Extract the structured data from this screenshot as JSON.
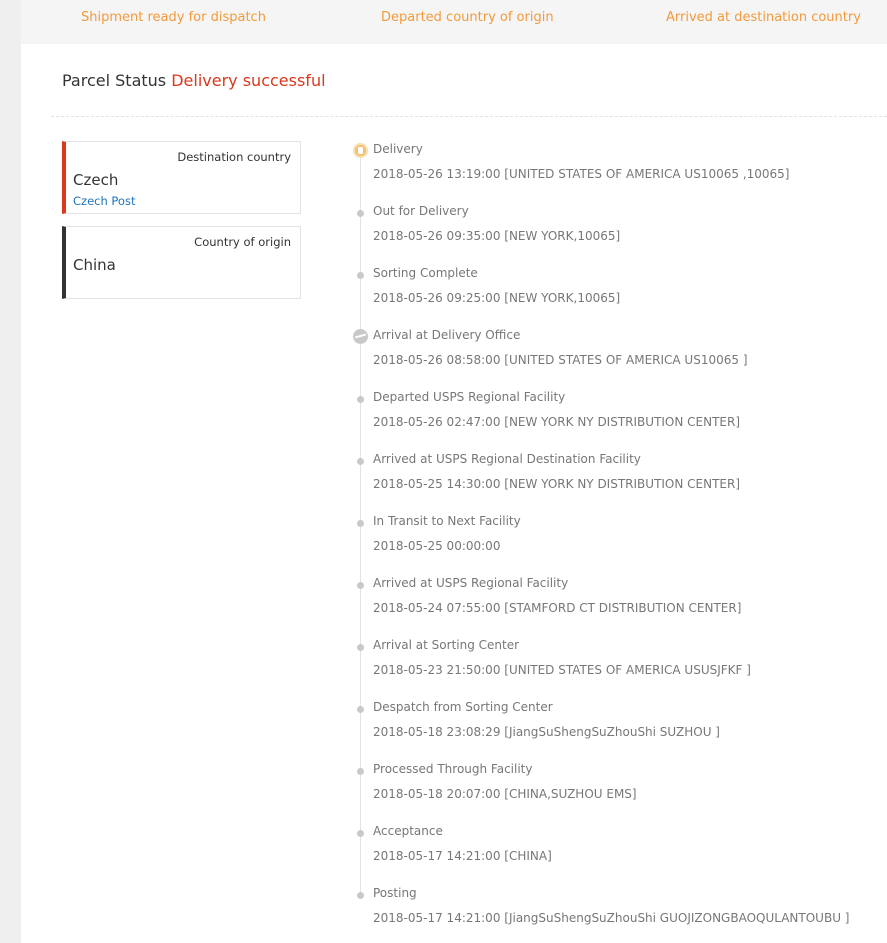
{
  "steps": [
    {
      "label": "Shipment ready for dispatch"
    },
    {
      "label": "Departed country of origin"
    },
    {
      "label": "Arrived at destination country"
    }
  ],
  "status": {
    "label": "Parcel Status",
    "value": "Delivery successful",
    "value_color": "#d9381e"
  },
  "destination": {
    "role": "Destination country",
    "country": "Czech",
    "carrier": "Czech Post",
    "accent": "#d9381e"
  },
  "origin": {
    "role": "Country of origin",
    "country": "China",
    "accent": "#333333"
  },
  "events": [
    {
      "title": "Delivery",
      "detail": "2018-05-26 13:19:00 [UNITED STATES OF AMERICA US10065 ,10065]",
      "icon": "delivered-icon"
    },
    {
      "title": "Out for Delivery",
      "detail": "2018-05-26 09:35:00 [NEW YORK,10065]",
      "icon": "dot-icon"
    },
    {
      "title": "Sorting Complete",
      "detail": "2018-05-26 09:25:00 [NEW YORK,10065]",
      "icon": "dot-icon"
    },
    {
      "title": "Arrival at Delivery Office",
      "detail": "2018-05-26 08:58:00 [UNITED STATES OF AMERICA US10065 ]",
      "icon": "plane-landing-icon"
    },
    {
      "title": "Departed USPS Regional Facility",
      "detail": "2018-05-26 02:47:00 [NEW YORK NY DISTRIBUTION CENTER]",
      "icon": "dot-icon"
    },
    {
      "title": "Arrived at USPS Regional Destination Facility",
      "detail": "2018-05-25 14:30:00 [NEW YORK NY DISTRIBUTION CENTER]",
      "icon": "dot-icon"
    },
    {
      "title": "In Transit to Next Facility",
      "detail": "2018-05-25 00:00:00",
      "icon": "dot-icon"
    },
    {
      "title": "Arrived at USPS Regional Facility",
      "detail": "2018-05-24 07:55:00 [STAMFORD CT DISTRIBUTION CENTER]",
      "icon": "dot-icon"
    },
    {
      "title": "Arrival at Sorting Center",
      "detail": "2018-05-23 21:50:00 [UNITED STATES OF AMERICA USUSJFKF ]",
      "icon": "dot-icon"
    },
    {
      "title": "Despatch from Sorting Center",
      "detail": "2018-05-18 23:08:29 [JiangSuShengSuZhouShi SUZHOU ]",
      "icon": "dot-icon"
    },
    {
      "title": "Processed Through Facility",
      "detail": "2018-05-18 20:07:00 [CHINA,SUZHOU EMS]",
      "icon": "dot-icon"
    },
    {
      "title": "Acceptance",
      "detail": "2018-05-17 14:21:00 [CHINA]",
      "icon": "dot-icon"
    },
    {
      "title": "Posting",
      "detail": "2018-05-17 14:21:00 [JiangSuShengSuZhouShi GUOJIZONGBAOQULANTOUBU ]",
      "icon": "dot-icon"
    }
  ],
  "colors": {
    "step_text": "#f39a3b",
    "timeline_text": "#777777",
    "link": "#1e73be"
  }
}
